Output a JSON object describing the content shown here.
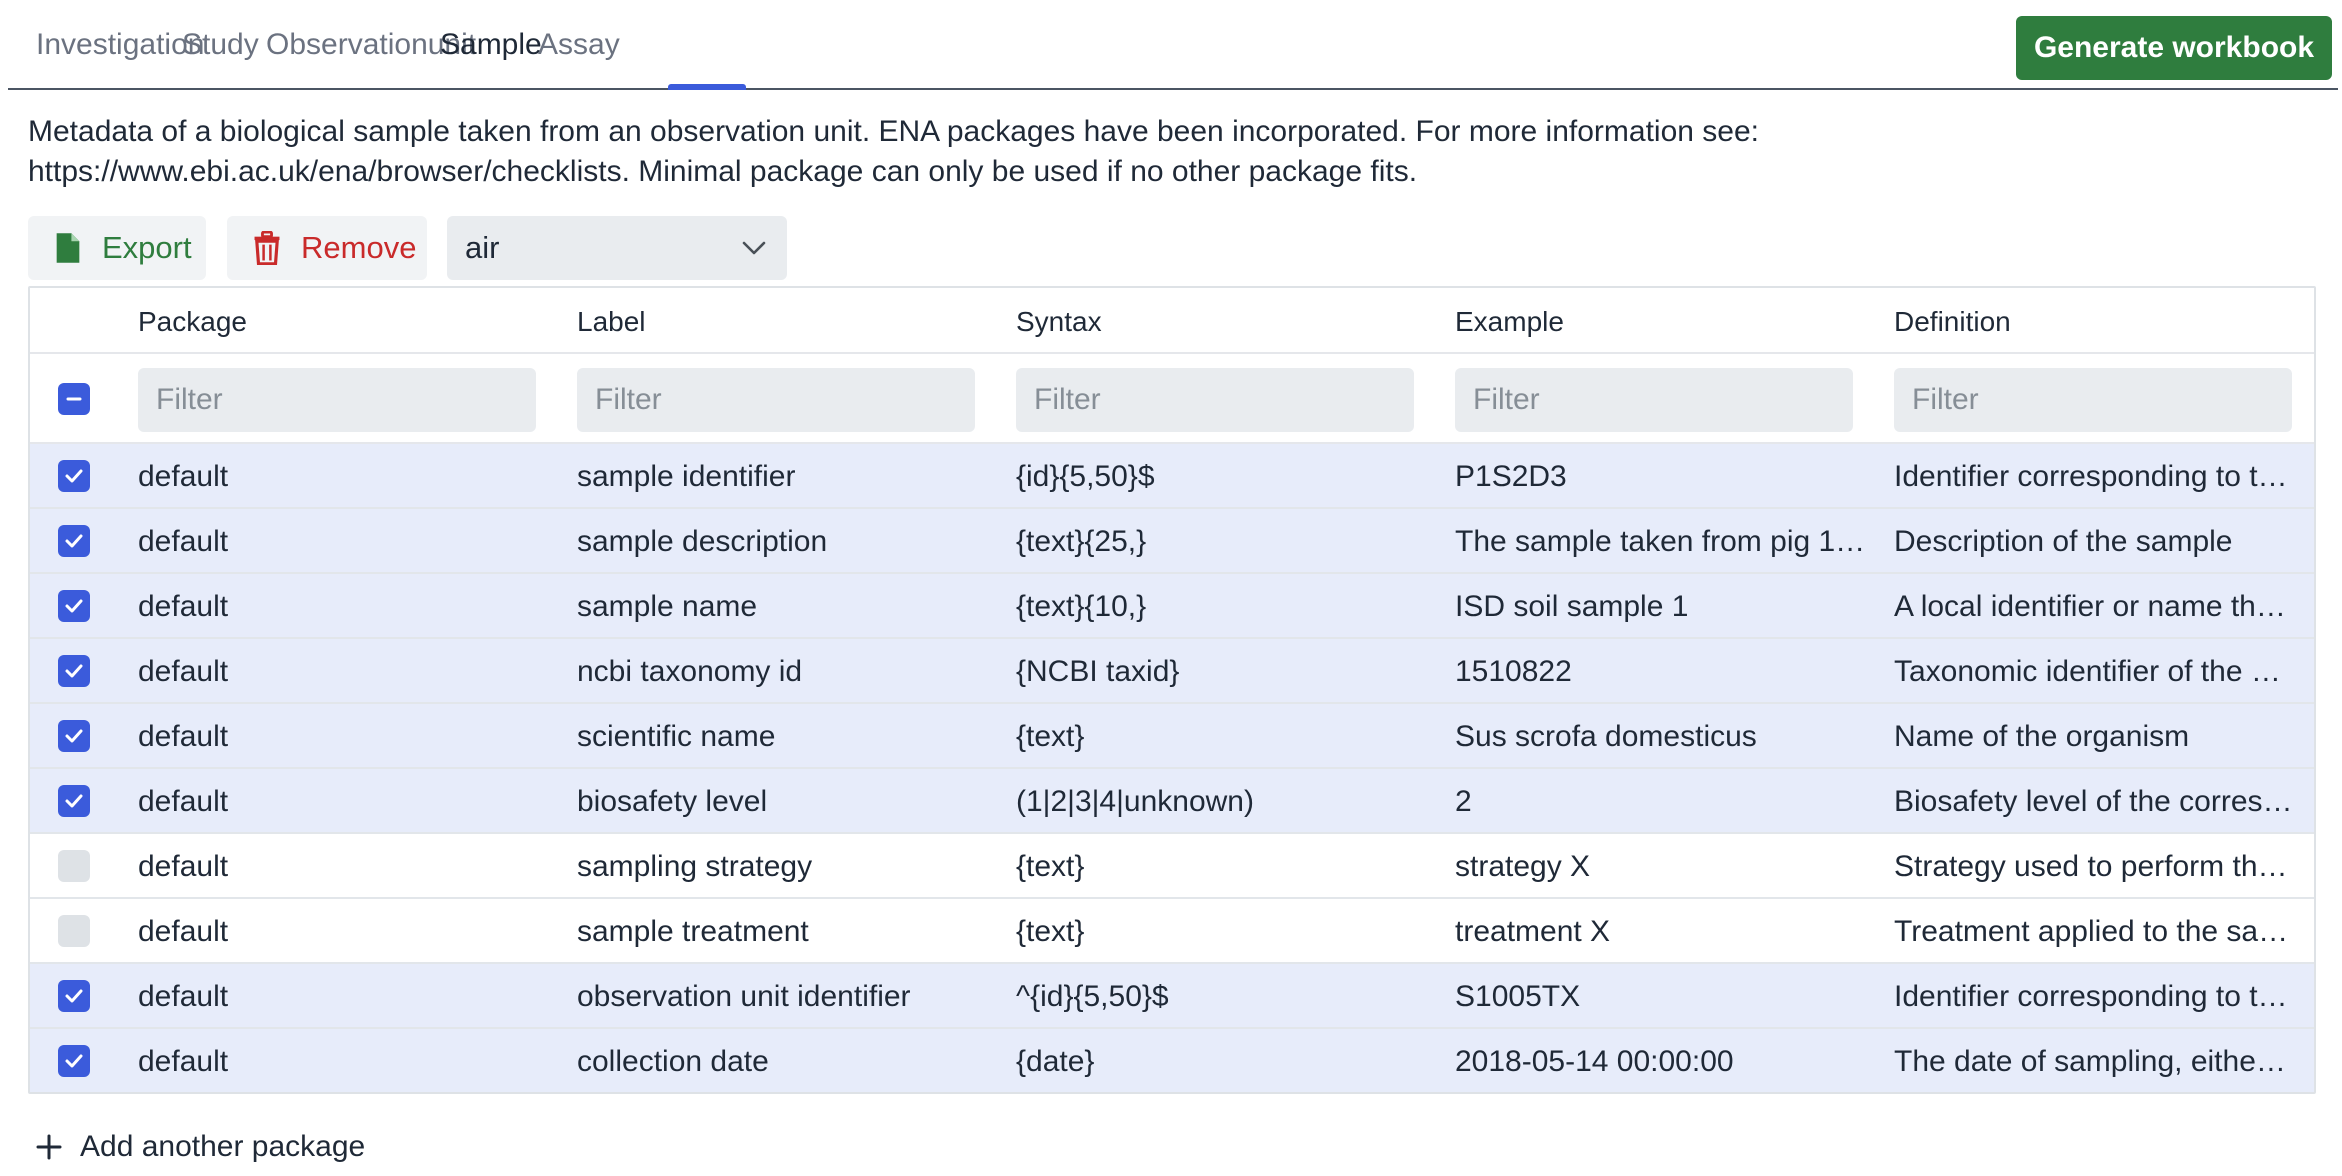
{
  "tabs": [
    {
      "label": "Investigation",
      "active": false
    },
    {
      "label": "Study",
      "active": false
    },
    {
      "label": "Observationunit",
      "active": false
    },
    {
      "label": "Sample",
      "active": true
    },
    {
      "label": "Assay",
      "active": false
    }
  ],
  "generate_button": "Generate workbook",
  "description": "Metadata of a biological sample taken from an observation unit. ENA packages have been incorporated. For more information see: https://www.ebi.ac.uk/ena/browser/checklists. Minimal package can only be used if no other package fits.",
  "toolbar": {
    "export_label": "Export",
    "remove_label": "Remove",
    "package_select_value": "air"
  },
  "table": {
    "columns": [
      "Package",
      "Label",
      "Syntax",
      "Example",
      "Definition"
    ],
    "filter_placeholder": "Filter",
    "rows": [
      {
        "checked": true,
        "package": "default",
        "label": "sample identifier",
        "syntax": "{id}{5,50}$",
        "example": "P1S2D3",
        "definition": "Identifier corresponding to t…"
      },
      {
        "checked": true,
        "package": "default",
        "label": "sample description",
        "syntax": "{text}{25,}",
        "example": "The sample taken from pig 1…",
        "definition": "Description of the sample"
      },
      {
        "checked": true,
        "package": "default",
        "label": "sample name",
        "syntax": "{text}{10,}",
        "example": "ISD soil sample 1",
        "definition": "A local identifier or name tha…"
      },
      {
        "checked": true,
        "package": "default",
        "label": "ncbi taxonomy id",
        "syntax": "{NCBI taxid}",
        "example": "1510822",
        "definition": "Taxonomic identifier of the s…"
      },
      {
        "checked": true,
        "package": "default",
        "label": "scientific name",
        "syntax": "{text}",
        "example": "Sus scrofa domesticus",
        "definition": "Name of the organism"
      },
      {
        "checked": true,
        "package": "default",
        "label": "biosafety level",
        "syntax": "(1|2|3|4|unknown)",
        "example": "2",
        "definition": "Biosafety level of the corres…"
      },
      {
        "checked": false,
        "package": "default",
        "label": "sampling strategy",
        "syntax": "{text}",
        "example": "strategy X",
        "definition": "Strategy used to perform th…"
      },
      {
        "checked": false,
        "package": "default",
        "label": "sample treatment",
        "syntax": "{text}",
        "example": "treatment X",
        "definition": "Treatment applied to the sa…"
      },
      {
        "checked": true,
        "package": "default",
        "label": "observation unit identifier",
        "syntax": "^{id}{5,50}$",
        "example": "S1005TX",
        "definition": "Identifier corresponding to t…"
      },
      {
        "checked": true,
        "package": "default",
        "label": "collection date",
        "syntax": "{date}",
        "example": "2018-05-14 00:00:00",
        "definition": "The date of sampling, either …"
      }
    ]
  },
  "add_package_label": "Add another package",
  "colors": {
    "accent": "#3b5bdb",
    "primary_button": "#2f7d3e",
    "remove": "#c92a2a",
    "selected_row": "#e7ecfa"
  },
  "icons": {
    "export": "file-icon",
    "remove": "trash-icon",
    "select": "chevron-down-icon",
    "add": "plus-icon",
    "header_checkbox": "minus-icon",
    "row_checkbox": "check-icon"
  }
}
